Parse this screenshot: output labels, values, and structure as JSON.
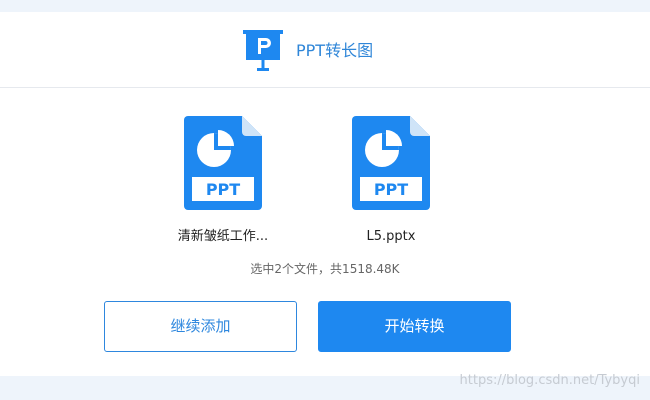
{
  "header": {
    "title": "PPT转长图"
  },
  "files": [
    {
      "name": "清新皱纸工作...",
      "type_label": "PPT"
    },
    {
      "name": "L5.pptx",
      "type_label": "PPT"
    }
  ],
  "summary": "选中2个文件，共1518.48K",
  "buttons": {
    "add_label": "继续添加",
    "start_label": "开始转换"
  },
  "watermark": "https://blog.csdn.net/Tybyqi",
  "colors": {
    "accent": "#1e88f0",
    "title": "#2f86d8",
    "icon_blue": "#1e88f0",
    "icon_fold": "#cfe4f8"
  }
}
